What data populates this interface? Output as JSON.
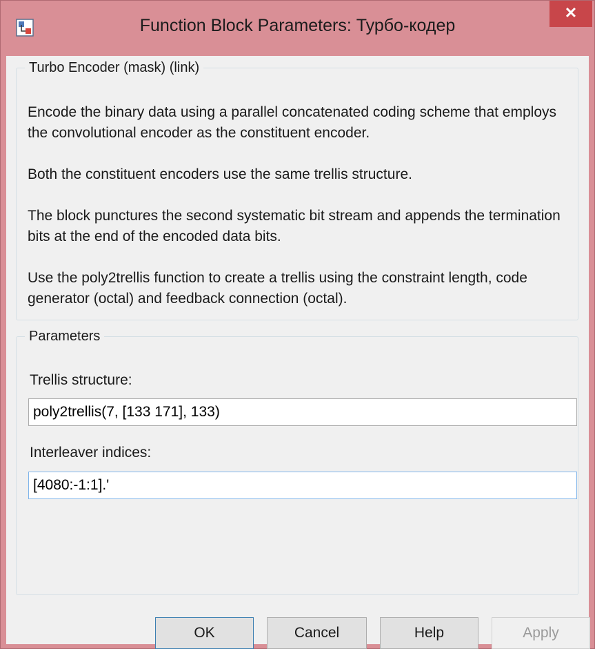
{
  "window": {
    "title": "Function Block Parameters: Турбо-кодер",
    "close_glyph": "✕",
    "icon": "simulink-block-icon"
  },
  "description": {
    "group_title": "Turbo Encoder (mask) (link)",
    "paragraphs": [
      "Encode the binary data using a parallel concatenated coding scheme that employs the convolutional encoder as the constituent encoder.",
      "Both the constituent encoders use the same trellis structure.",
      "The block punctures the second systematic bit stream and appends the termination bits at the end of the encoded data bits.",
      "Use the poly2trellis function to create a trellis using the constraint length, code generator (octal) and feedback connection (octal)."
    ]
  },
  "parameters": {
    "group_title": "Parameters",
    "trellis_label": "Trellis structure:",
    "trellis_value": "poly2trellis(7, [133 171], 133)",
    "interleaver_label": "Interleaver indices:",
    "interleaver_value": "[4080:-1:1].'"
  },
  "buttons": {
    "ok": "OK",
    "cancel": "Cancel",
    "help": "Help",
    "apply": "Apply"
  },
  "colors": {
    "titlebar": "#d98f96",
    "close_button": "#c8464a",
    "client_bg": "#f0f0f0"
  }
}
